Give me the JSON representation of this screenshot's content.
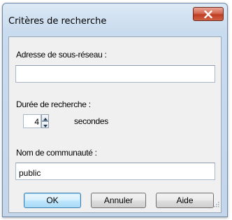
{
  "window": {
    "title": "Critères de recherche",
    "close_icon": "close-x-icon"
  },
  "subnet": {
    "label": "Adresse de sous-réseau :",
    "value": ""
  },
  "duration": {
    "label": "Durée de recherche :",
    "value": "4",
    "unit": "secondes"
  },
  "community": {
    "label": "Nom de communauté :",
    "value": "public"
  },
  "buttons": {
    "ok": "OK",
    "cancel": "Annuler",
    "help": "Aide"
  },
  "colors": {
    "close_button": "#c8432a",
    "default_button_border": "#3c7fb1",
    "dialog_background": "#f0f0f0"
  }
}
